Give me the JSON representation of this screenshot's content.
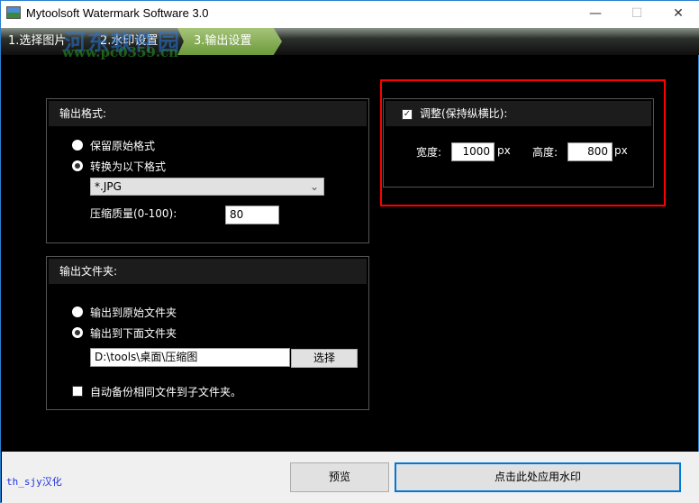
{
  "window": {
    "title": "Mytoolsoft Watermark Software 3.0",
    "minimize": "—",
    "maximize": "☐",
    "close": "✕"
  },
  "tabs": [
    {
      "label": "1.选择图片"
    },
    {
      "label": "2.水印设置"
    },
    {
      "label": "3.输出设置"
    }
  ],
  "watermark": {
    "site_name": "河东软件园",
    "site_url": "www.pc0359.cn"
  },
  "output_format": {
    "title": "输出格式:",
    "keep_original": "保留原始格式",
    "convert_to": "转换为以下格式",
    "selected_format": "*.JPG",
    "quality_label": "压缩质量(0-100):",
    "quality_value": "80"
  },
  "output_folder": {
    "title": "输出文件夹:",
    "to_original": "输出到原始文件夹",
    "to_below": "输出到下面文件夹",
    "path": "D:\\tools\\桌面\\压缩图",
    "browse": "选择",
    "backup_label": "自动备份相同文件到子文件夹。"
  },
  "resize": {
    "label": "调整(保持纵横比):",
    "checked": true,
    "width_label": "宽度:",
    "width_value": "1000",
    "height_label": "高度:",
    "height_value": "800",
    "unit": "px"
  },
  "footer": {
    "credit": "th_sjy汉化",
    "preview": "预览",
    "apply": "点击此处应用水印"
  }
}
